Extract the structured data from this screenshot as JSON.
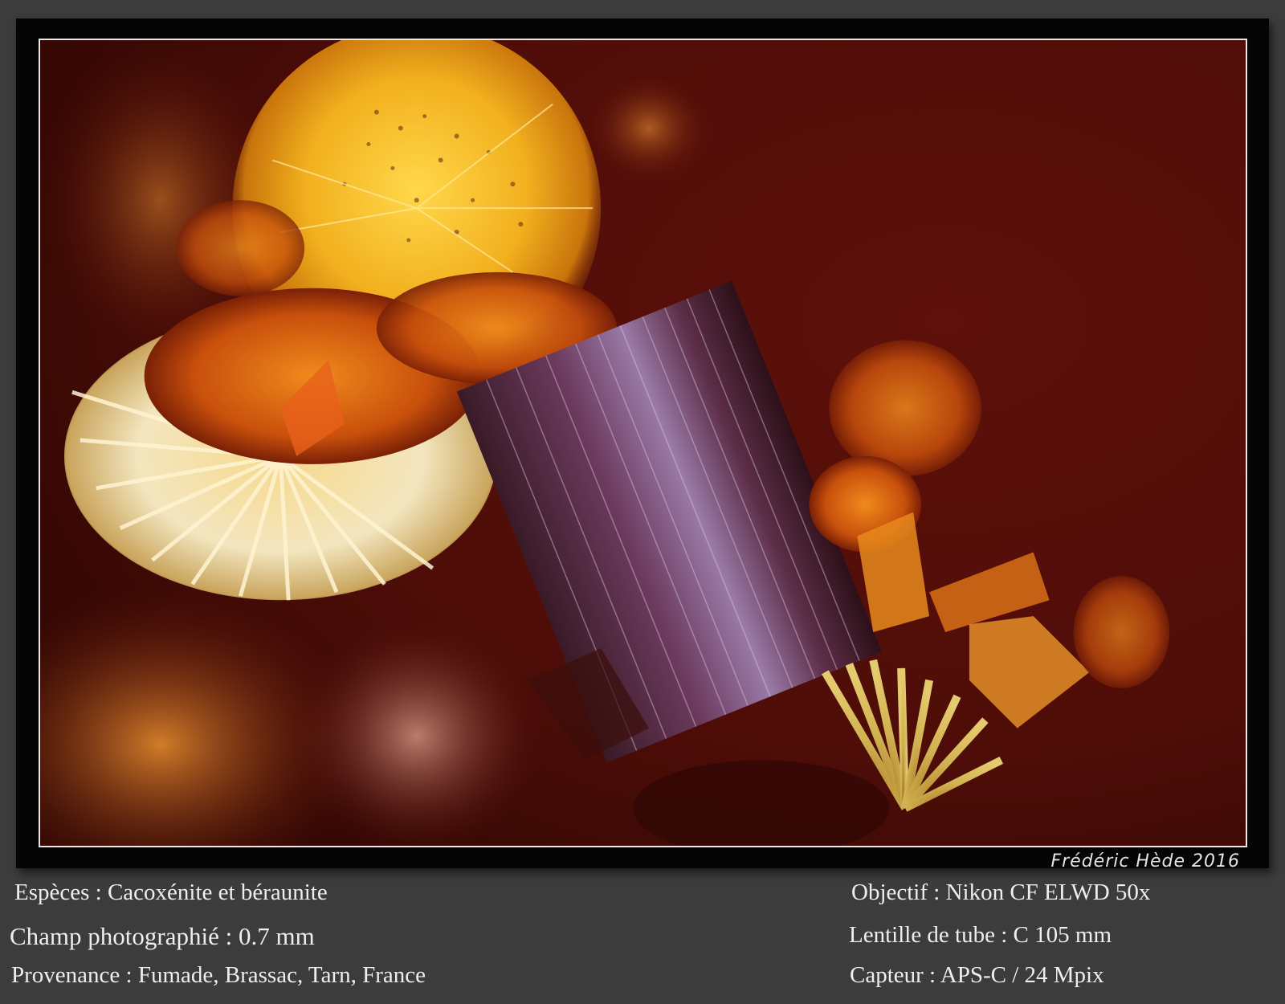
{
  "signature": "Frédéric Hède 2016",
  "caption": {
    "left": [
      "Espèces : Cacoxénite et béraunite",
      "Champ photographié : 0.7 mm",
      "Provenance : Fumade, Brassac, Tarn, France"
    ],
    "right": [
      "Objectif : Nikon CF ELWD 50x",
      "Lentille de tube : C 105 mm",
      "Capteur : APS-C / 24 Mpix"
    ]
  },
  "colors": {
    "background": "#3c3c3c",
    "frame": "#050505",
    "photo_bg": "#5a0f08",
    "crystal": "#6b3a5c",
    "yellow": "#f0b21a",
    "orange": "#d5620f"
  }
}
